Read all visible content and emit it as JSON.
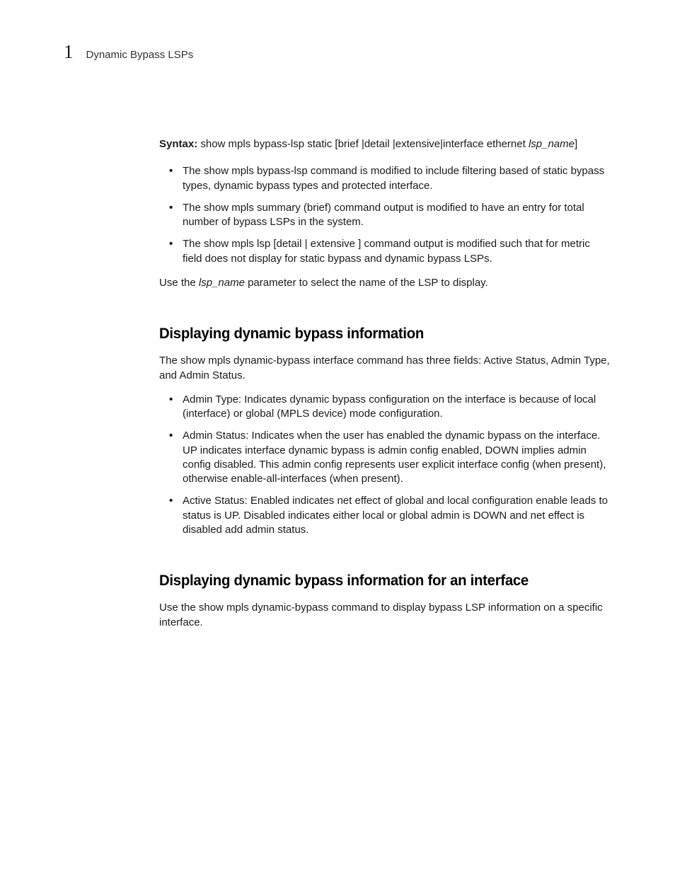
{
  "header": {
    "chapter": "1",
    "title": "Dynamic Bypass LSPs"
  },
  "syntax": {
    "label": "Syntax:",
    "spacer": "  ",
    "text_prefix": "show mpls bypass-lsp static [brief |detail |extensive|interface ethernet ",
    "variable": "lsp_name",
    "text_suffix": "]"
  },
  "bullets_top": [
    "The show mpls bypass-lsp command is modified to include filtering based of static bypass types, dynamic bypass types and protected interface.",
    "The show mpls summary (brief) command output is modified to have an entry for total number of bypass LSPs in the system.",
    "The show mpls lsp [detail | extensive ] command output is modified such that for metric field does not display for static bypass and dynamic bypass LSPs."
  ],
  "use_para": {
    "before": "Use the ",
    "var": "lsp_name",
    "after": " parameter to select the name of the LSP to display."
  },
  "section1": {
    "heading": "Displaying dynamic bypass information",
    "intro": "The show mpls dynamic-bypass interface command has three fields: Active Status, Admin Type, and Admin Status.",
    "bullets": [
      "Admin Type: Indicates dynamic bypass configuration on the interface is because of local (interface) or global (MPLS device) mode configuration.",
      "Admin Status: Indicates when the user has enabled the dynamic bypass on the interface. UP indicates interface dynamic bypass is admin config enabled, DOWN implies admin config disabled. This admin config represents user explicit interface config (when present), otherwise enable-all-interfaces (when present).",
      "Active Status: Enabled indicates net effect of global and local configuration enable leads to status is UP. Disabled indicates either local or global admin is DOWN and net effect is disabled add admin status."
    ]
  },
  "section2": {
    "heading": "Displaying dynamic bypass information for an interface",
    "intro": "Use the show mpls dynamic-bypass command to display bypass LSP information on a specific interface."
  }
}
